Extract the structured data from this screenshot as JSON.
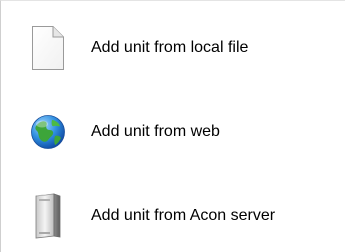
{
  "menu": {
    "items": [
      {
        "label": "Add unit from local file",
        "icon": "document-icon"
      },
      {
        "label": "Add unit from web",
        "icon": "globe-icon"
      },
      {
        "label": "Add unit from Acon server",
        "icon": "server-icon"
      }
    ]
  }
}
